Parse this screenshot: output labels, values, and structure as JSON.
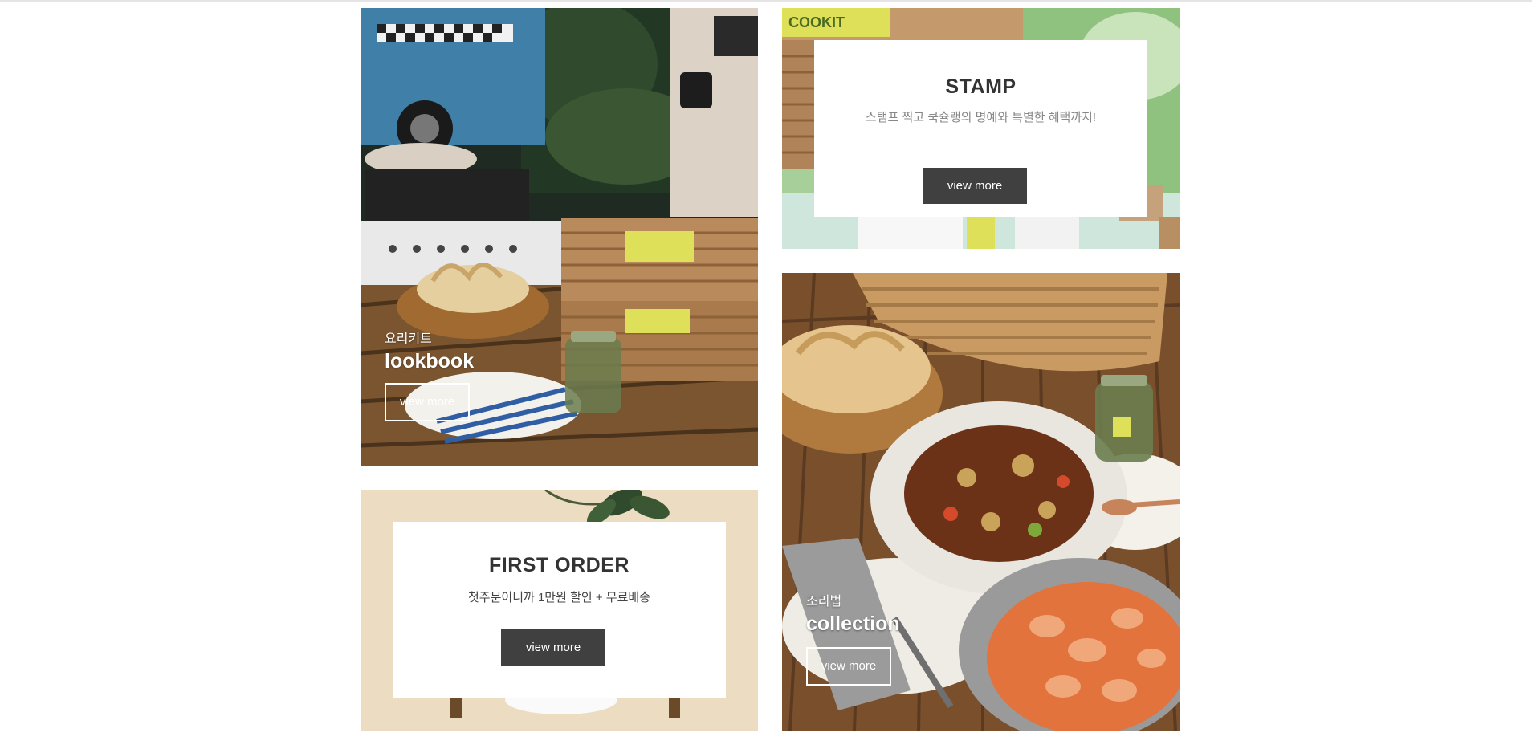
{
  "lookbook": {
    "subtitle": "요리키트",
    "title": "lookbook",
    "button": "view more"
  },
  "stamp": {
    "title": "STAMP",
    "description": "스탬프 찍고 쿡슐랭의 명예와 특별한 혜택까지!",
    "button": "view more",
    "brand_box_text": "COOKIT"
  },
  "first_order": {
    "title": "FIRST ORDER",
    "description": "첫주문이니까 1만원 할인 + 무료배송",
    "button": "view more"
  },
  "collection": {
    "subtitle": "조리법",
    "title": "collection",
    "button": "view more"
  },
  "colors": {
    "dark_button": "#404040",
    "card_background": "#ffffff",
    "first_order_bg": "#ecdcc2",
    "stamp_bg": "#a7cf9a"
  }
}
